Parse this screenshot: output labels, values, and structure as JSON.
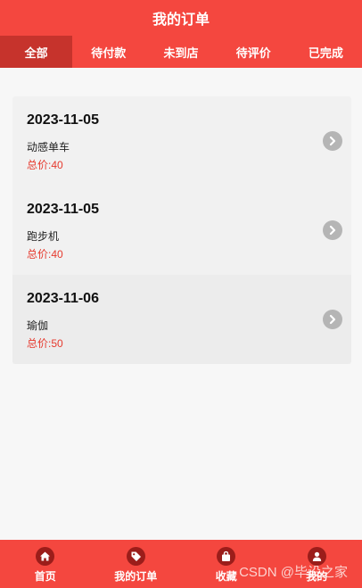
{
  "header": {
    "title": "我的订单"
  },
  "tabs": [
    {
      "label": "全部",
      "active": true
    },
    {
      "label": "待付款",
      "active": false
    },
    {
      "label": "未到店",
      "active": false
    },
    {
      "label": "待评价",
      "active": false
    },
    {
      "label": "已完成",
      "active": false
    }
  ],
  "orders": [
    {
      "date": "2023-11-05",
      "name": "动感单车",
      "total_label": "总价:",
      "total": "40",
      "icon": "chevron-right-icon"
    },
    {
      "date": "2023-11-05",
      "name": "跑步机",
      "total_label": "总价:",
      "total": "40",
      "icon": "chevron-right-icon"
    },
    {
      "date": "2023-11-06",
      "name": "瑜伽",
      "total_label": "总价:",
      "total": "50",
      "icon": "chevron-right-icon"
    }
  ],
  "bottom_nav": [
    {
      "label": "首页",
      "icon": "home-icon"
    },
    {
      "label": "我的订单",
      "icon": "tag-icon"
    },
    {
      "label": "收藏",
      "icon": "bag-icon"
    },
    {
      "label": "我的",
      "icon": "user-icon"
    }
  ],
  "watermark": "CSDN @毕设之家",
  "colors": {
    "primary": "#f4473f",
    "active_tab": "#c6332c",
    "price": "#e63a2e"
  }
}
